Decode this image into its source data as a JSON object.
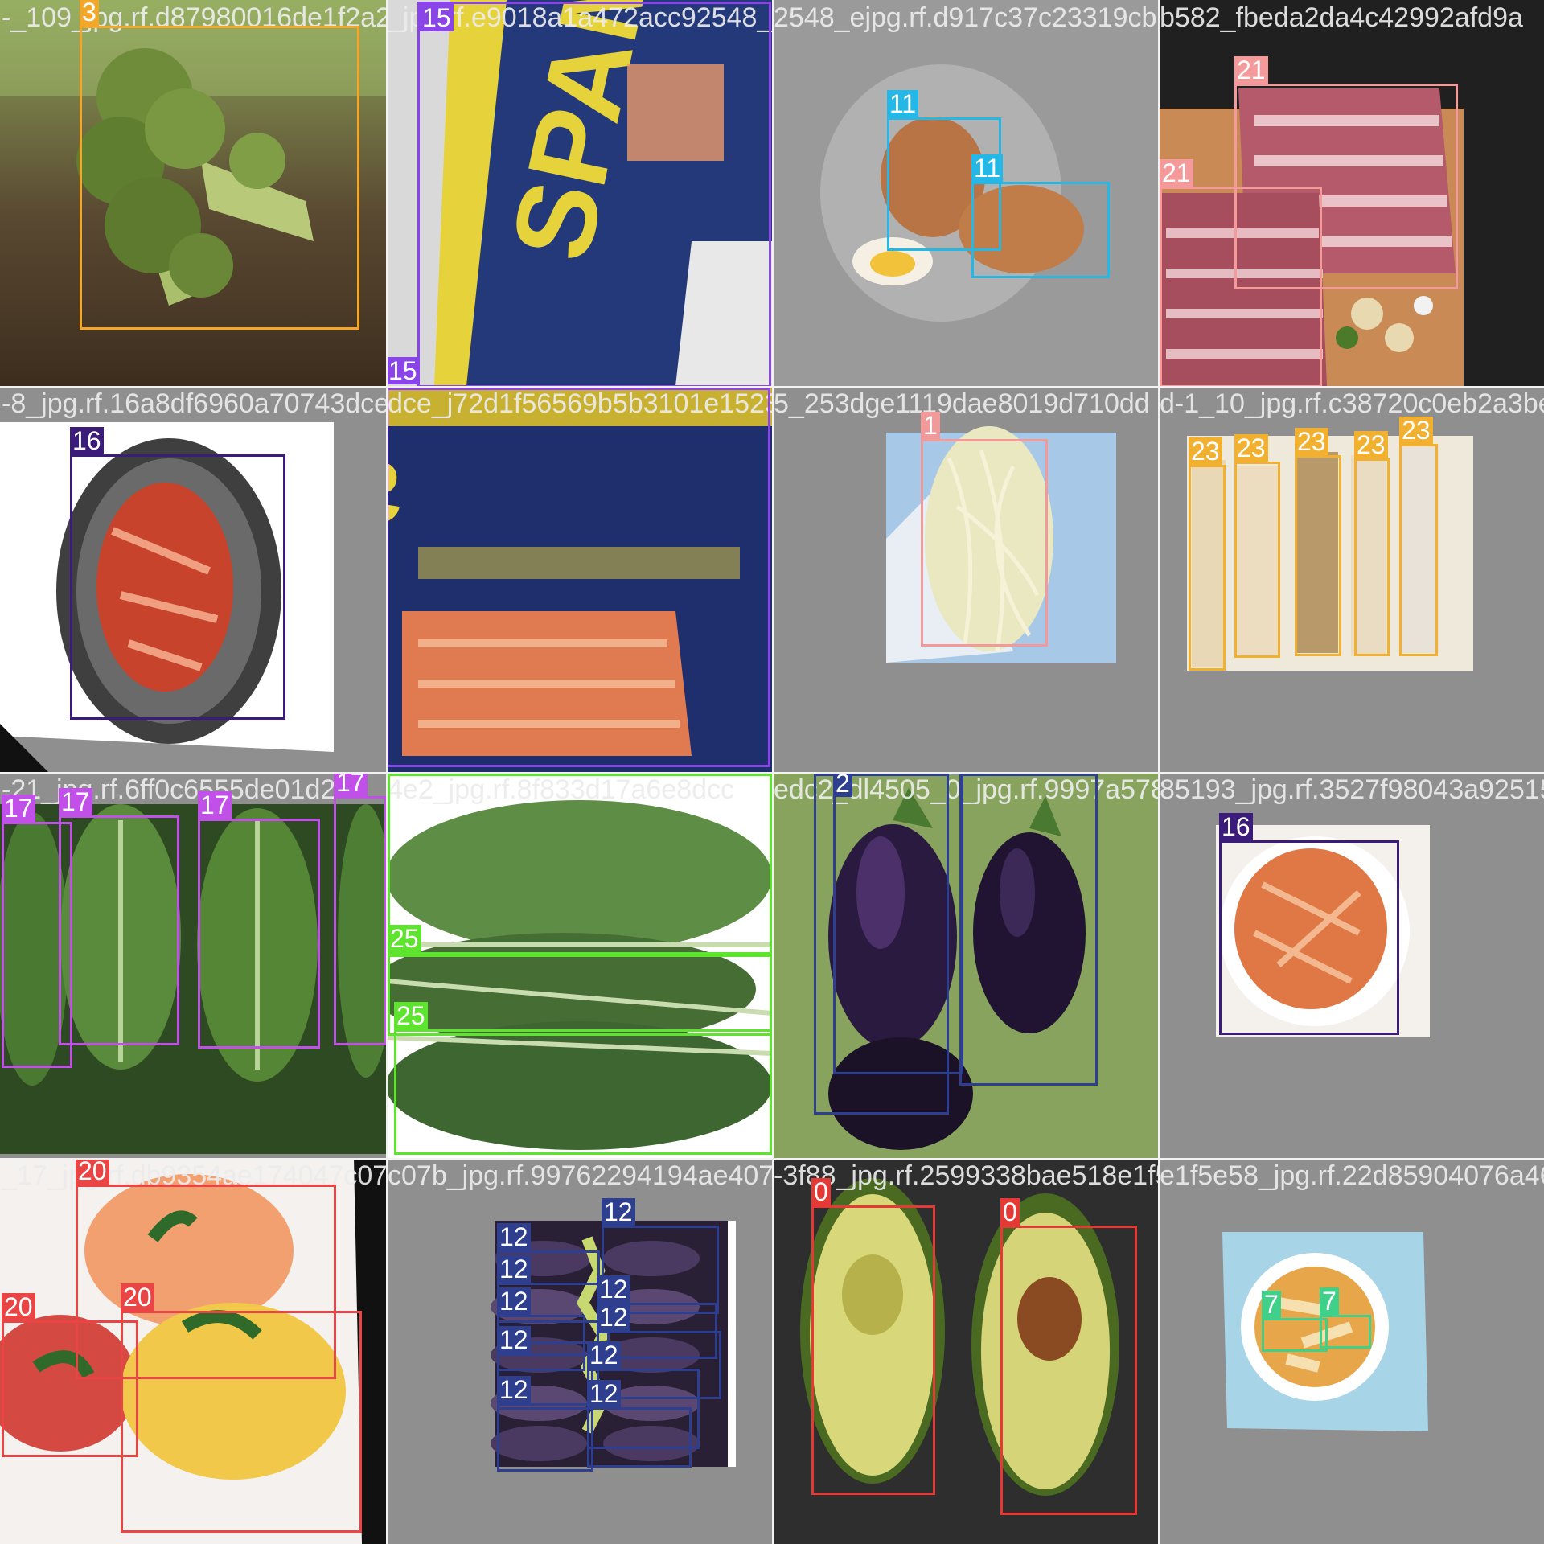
{
  "colors": {
    "c0": "#e53935",
    "c1": "#f29a9a",
    "c3": "#f2a72a",
    "c7": "#3fd08a",
    "c11": "#25b8e6",
    "c12": "#2e3f8f",
    "c15": "#8a45e8",
    "c16": "#3b1c7a",
    "c17": "#c050e8",
    "c20": "#e94545",
    "c21": "#f49a9a",
    "c23": "#f2b030",
    "c25": "#5ee42e"
  },
  "tiles": [
    {
      "filename": "-_109_jpg.rf.d87980016de1f2a2803249e918a1",
      "boxes": [
        {
          "label": "3"
        }
      ]
    },
    {
      "filename": "_jpg.rf.e9018a1a472acc92548_ejpg.rf.c1917",
      "boxes": [
        {
          "label": "15"
        },
        {
          "label": "15"
        }
      ]
    },
    {
      "filename": "2548_ejpg.rf.d917c37c23319cb582_fbed2",
      "boxes": [
        {
          "label": "11"
        },
        {
          "label": "11"
        }
      ]
    },
    {
      "filename": "b582_fbeda2da4c42992afd9a",
      "boxes": [
        {
          "label": "21"
        },
        {
          "label": "21"
        }
      ]
    },
    {
      "filename": "-8_jpg.rf.16a8df6960a70743dce_j72d1f56569",
      "boxes": [
        {
          "label": "16"
        }
      ]
    },
    {
      "filename": "dce_j72d1f56569b5b3101e1523_dge1119dae",
      "boxes": [
        {
          "label": "15"
        }
      ]
    },
    {
      "filename": "5_253dge1119dae8019d710dd",
      "boxes": [
        {
          "label": "1"
        }
      ]
    },
    {
      "filename": "d-1_10_jpg.rf.c38720c0eb2a3be",
      "boxes": [
        {
          "label": "23"
        },
        {
          "label": "23"
        },
        {
          "label": "23"
        },
        {
          "label": "23"
        },
        {
          "label": "23"
        }
      ]
    },
    {
      "filename": "-21_jpg.rf.6ff0c6555de01d24",
      "boxes": [
        {
          "label": "17"
        },
        {
          "label": "17"
        },
        {
          "label": "17"
        },
        {
          "label": "17"
        }
      ]
    },
    {
      "filename": "4e2_jpg.rf.8f833d17a6e8dcc",
      "boxes": [
        {
          "label": "25"
        },
        {
          "label": "25"
        },
        {
          "label": "25"
        }
      ]
    },
    {
      "filename": "edc2_dl4505_0_jpg.rf.9997a5785193",
      "boxes": [
        {
          "label": "12"
        },
        {
          "label": "2"
        },
        {
          "label": "12"
        }
      ]
    },
    {
      "filename": "85193_jpg.rf.3527f98043a92515",
      "boxes": [
        {
          "label": "16"
        }
      ]
    },
    {
      "filename": "_17_jpg.rf.db9354ae174047c07b",
      "boxes": [
        {
          "label": "20"
        },
        {
          "label": "20"
        },
        {
          "label": "20"
        }
      ]
    },
    {
      "filename": "c07b_jpg.rf.99762294194ae4073f88",
      "boxes": [
        {
          "label": "12"
        },
        {
          "label": "12"
        },
        {
          "label": "12"
        },
        {
          "label": "12"
        },
        {
          "label": "12"
        },
        {
          "label": "12"
        },
        {
          "label": "12"
        },
        {
          "label": "12"
        },
        {
          "label": "12"
        },
        {
          "label": "12"
        }
      ]
    },
    {
      "filename": "-3f88_jpg.rf.2599338bae518e1f5e58",
      "boxes": [
        {
          "label": "0"
        },
        {
          "label": "0"
        }
      ]
    },
    {
      "filename": "e1f5e58_jpg.rf.22d85904076a46",
      "boxes": [
        {
          "label": "7"
        },
        {
          "label": "7"
        }
      ]
    }
  ]
}
